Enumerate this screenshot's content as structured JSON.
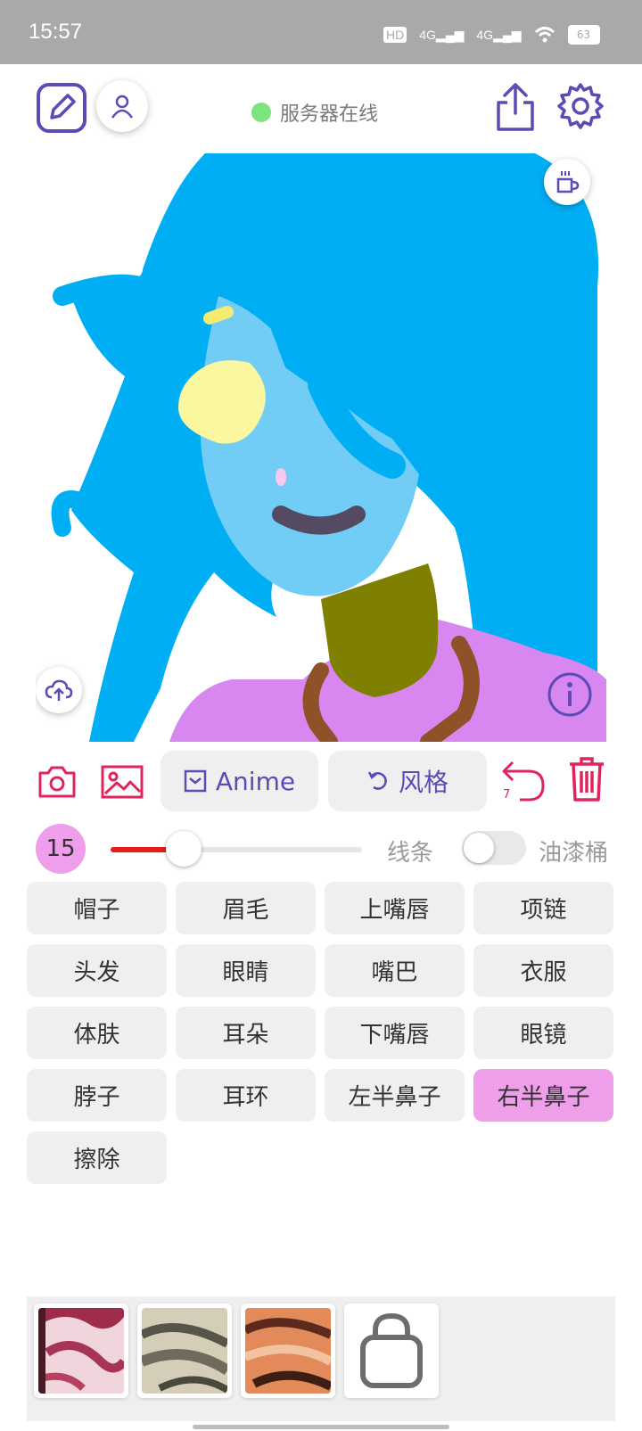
{
  "status_bar": {
    "time": "15:57",
    "network": [
      "HD",
      "4G",
      "4G"
    ],
    "battery": "63"
  },
  "header": {
    "server_status": "服务器在线"
  },
  "tools": {
    "anime_label": "Anime",
    "style_label": "风格",
    "undo_count": "7"
  },
  "brush": {
    "size": "15",
    "size_fraction": 0.29,
    "mode_line": "线条",
    "mode_bucket": "油漆桶",
    "bucket_enabled": false
  },
  "parts": [
    "帽子",
    "眉毛",
    "上嘴唇",
    "项链",
    "头发",
    "眼睛",
    "嘴巴",
    "衣服",
    "体肤",
    "耳朵",
    "下嘴唇",
    "眼镜",
    "脖子",
    "耳环",
    "左半鼻子",
    "右半鼻子",
    "擦除"
  ],
  "selected_part": "右半鼻子",
  "colors": {
    "accent": "#5a4bb5",
    "red": "#e0245e",
    "selected": "#ef9eea"
  },
  "results": {
    "thumbnails": 3,
    "bag_icon": "shopping-bag-icon"
  }
}
